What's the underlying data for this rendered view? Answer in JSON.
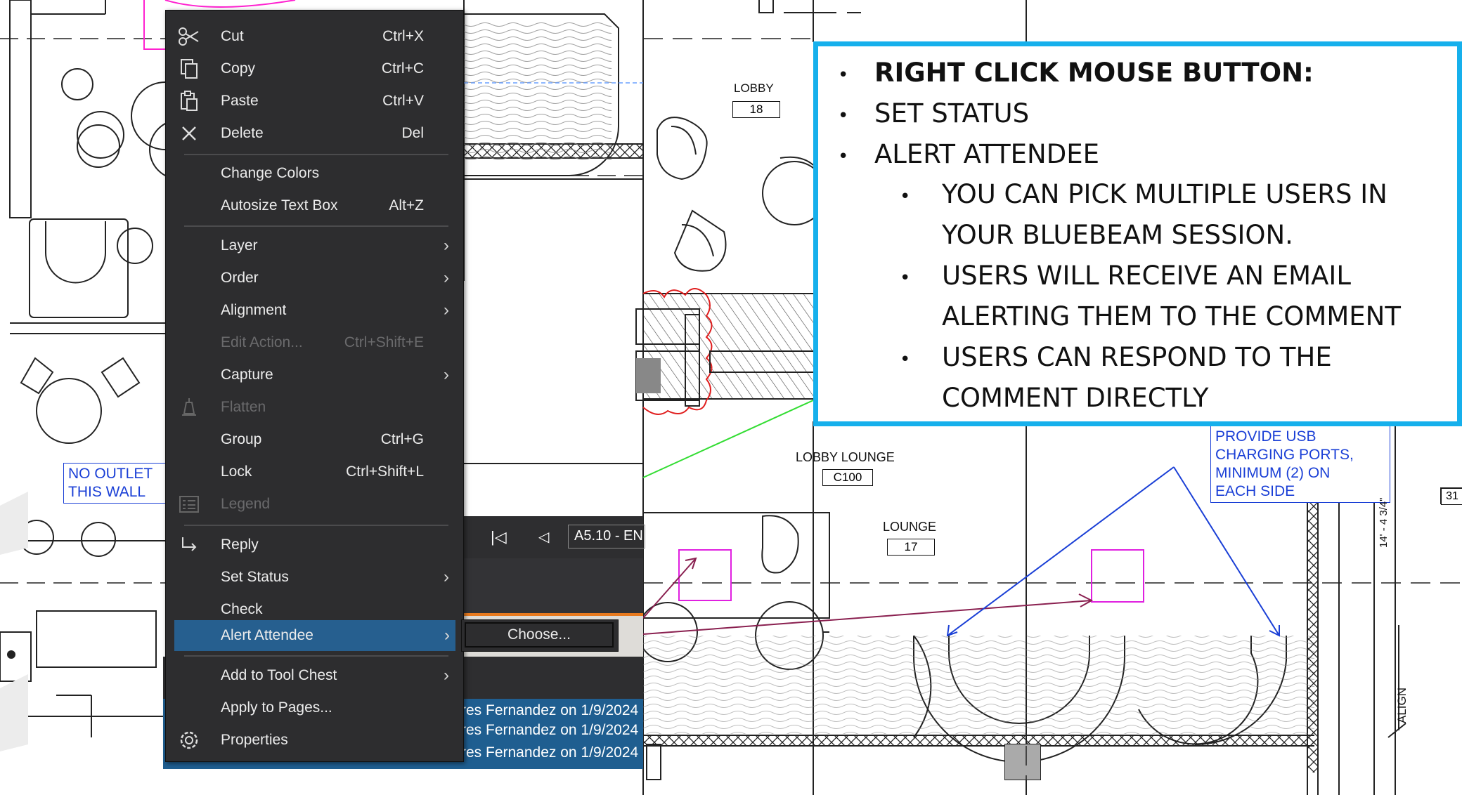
{
  "context_menu": {
    "items": [
      {
        "label": "Cut",
        "shortcut": "Ctrl+X",
        "icon": "scissors-icon"
      },
      {
        "label": "Copy",
        "shortcut": "Ctrl+C",
        "icon": "copy-icon"
      },
      {
        "label": "Paste",
        "shortcut": "Ctrl+V",
        "icon": "paste-icon"
      },
      {
        "label": "Delete",
        "shortcut": "Del",
        "icon": "close-icon"
      },
      {
        "label": "Change Colors",
        "shortcut": ""
      },
      {
        "label": "Autosize Text Box",
        "shortcut": "Alt+Z"
      },
      {
        "label": "Layer",
        "submenu": true
      },
      {
        "label": "Order",
        "submenu": true
      },
      {
        "label": "Alignment",
        "submenu": true
      },
      {
        "label": "Edit Action...",
        "shortcut": "Ctrl+Shift+E",
        "disabled": true
      },
      {
        "label": "Capture",
        "submenu": true
      },
      {
        "label": "Flatten",
        "disabled": true,
        "icon": "flatten-icon"
      },
      {
        "label": "Group",
        "shortcut": "Ctrl+G"
      },
      {
        "label": "Lock",
        "shortcut": "Ctrl+Shift+L"
      },
      {
        "label": "Legend",
        "disabled": true,
        "icon": "legend-icon"
      },
      {
        "label": "Reply",
        "icon": "reply-icon"
      },
      {
        "label": "Set Status",
        "submenu": true
      },
      {
        "label": "Check"
      },
      {
        "label": "Alert Attendee",
        "submenu": true,
        "highlighted": true
      },
      {
        "label": "Add to Tool Chest",
        "submenu": true
      },
      {
        "label": "Apply to Pages..."
      },
      {
        "label": "Properties",
        "icon": "gear-icon"
      }
    ],
    "submenu_choose": "Choose..."
  },
  "bluebeam": {
    "page_label": "A5.10 - EN",
    "comments": [
      "res Fernandez on 1/9/2024",
      "res Fernandez on 1/9/2024",
      "res Fernandez on 1/9/2024"
    ]
  },
  "plan": {
    "lobby": {
      "name": "LOBBY",
      "number": "18"
    },
    "lobby_lounge": {
      "name": "LOBBY LOUNGE",
      "number": "C100"
    },
    "lounge": {
      "name": "LOUNGE",
      "number": "17"
    },
    "note_outlet": [
      "NO OUTLET",
      "THIS WALL"
    ],
    "note_usb": [
      "PROVIDE USB",
      "CHARGING PORTS,",
      "MINIMUM (2) ON",
      "EACH SIDE"
    ],
    "dimension": "14' - 4 3/4\"",
    "align_label": "ALIGN",
    "edge_tag": "31"
  },
  "callout": {
    "heading": "RIGHT CLICK MOUSE BUTTON:",
    "items": [
      "SET STATUS",
      "ALERT ATTENDEE"
    ],
    "subitems": [
      [
        "YOU CAN PICK MULTIPLE USERS IN",
        "YOUR BLUEBEAM SESSION."
      ],
      [
        "USERS WILL RECEIVE AN EMAIL",
        "ALERTING THEM TO THE COMMENT"
      ],
      [
        "USERS CAN RESPOND TO THE",
        "COMMENT DIRECTLY"
      ]
    ],
    "border_color": "#16b0ec"
  }
}
